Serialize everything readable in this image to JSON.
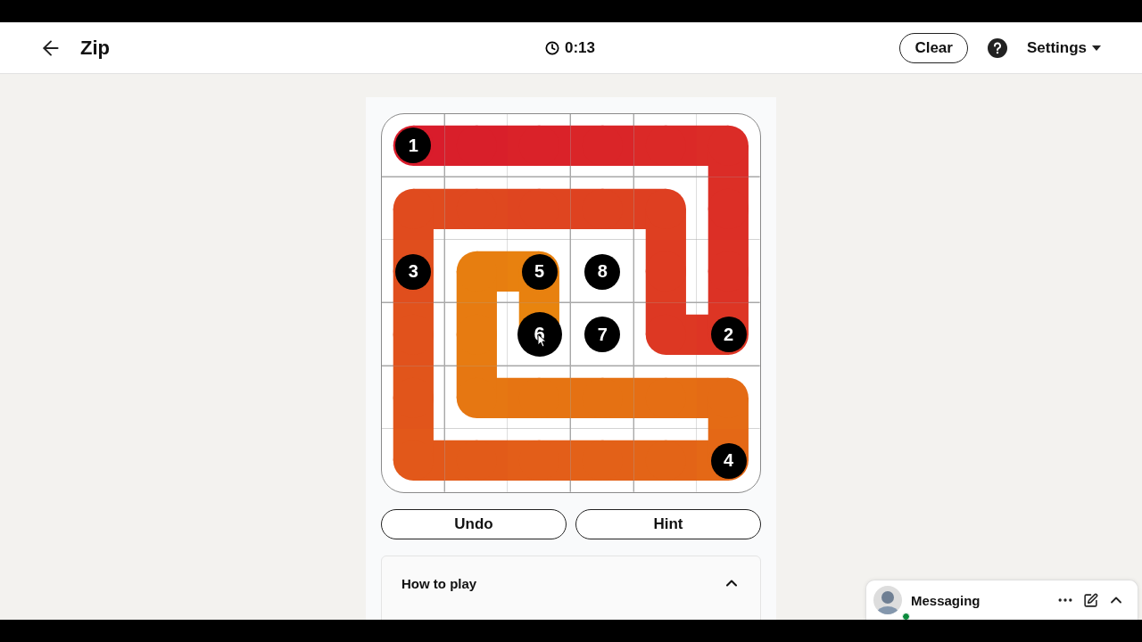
{
  "header": {
    "title": "Zip",
    "timer": "0:13",
    "clear_button": "Clear",
    "settings": "Settings"
  },
  "board": {
    "rows": [
      [
        {
          "kind": "dot",
          "label": "1",
          "current": false,
          "joins_right": true,
          "joins_down": false
        },
        {
          "kind": "empty",
          "joins_right": true,
          "joins_down": false
        },
        {
          "kind": "empty",
          "joins_right": true,
          "joins_down": false
        },
        {
          "kind": "empty",
          "joins_right": true,
          "joins_down": false
        },
        {
          "kind": "empty",
          "joins_right": true,
          "joins_down": false
        },
        {
          "kind": "empty",
          "joins_right": false,
          "joins_down": true
        }
      ],
      [
        {
          "kind": "empty",
          "joins_right": true,
          "joins_down": true
        },
        {
          "kind": "empty",
          "joins_right": true,
          "joins_down": false
        },
        {
          "kind": "empty",
          "joins_right": true,
          "joins_down": false
        },
        {
          "kind": "empty",
          "joins_right": true,
          "joins_down": false
        },
        {
          "kind": "empty",
          "joins_right": false,
          "joins_down": true
        },
        {
          "kind": "empty",
          "joins_right": false,
          "joins_down": true
        }
      ],
      [
        {
          "kind": "dot",
          "label": "3",
          "current": false,
          "joins_right": false,
          "joins_down": true
        },
        {
          "kind": "empty",
          "joins_right": true,
          "joins_down": true
        },
        {
          "kind": "dot",
          "label": "5",
          "current": false,
          "joins_right": false,
          "joins_down": true
        },
        {
          "kind": "dot",
          "label": "8",
          "current": false,
          "joins_right": false,
          "joins_down": false
        },
        {
          "kind": "empty",
          "joins_right": false,
          "joins_down": true
        },
        {
          "kind": "empty",
          "joins_right": false,
          "joins_down": true
        }
      ],
      [
        {
          "kind": "empty",
          "joins_right": false,
          "joins_down": true
        },
        {
          "kind": "empty",
          "joins_right": false,
          "joins_down": true
        },
        {
          "kind": "dot",
          "label": "6",
          "current": true,
          "joins_right": false,
          "joins_down": false
        },
        {
          "kind": "dot",
          "label": "7",
          "current": false,
          "joins_right": false,
          "joins_down": false
        },
        {
          "kind": "empty",
          "joins_right": true,
          "joins_down": false
        },
        {
          "kind": "dot",
          "label": "2",
          "current": false,
          "joins_right": false,
          "joins_down": false
        }
      ],
      [
        {
          "kind": "empty",
          "joins_right": false,
          "joins_down": true
        },
        {
          "kind": "empty",
          "joins_right": true,
          "joins_down": false
        },
        {
          "kind": "empty",
          "joins_right": true,
          "joins_down": false
        },
        {
          "kind": "empty",
          "joins_right": true,
          "joins_down": false
        },
        {
          "kind": "empty",
          "joins_right": true,
          "joins_down": false
        },
        {
          "kind": "empty",
          "joins_right": false,
          "joins_down": true
        }
      ],
      [
        {
          "kind": "empty",
          "joins_right": true,
          "joins_down": false
        },
        {
          "kind": "empty",
          "joins_right": true,
          "joins_down": false
        },
        {
          "kind": "empty",
          "joins_right": true,
          "joins_down": false
        },
        {
          "kind": "empty",
          "joins_right": true,
          "joins_down": false
        },
        {
          "kind": "empty",
          "joins_right": true,
          "joins_down": false
        },
        {
          "kind": "dot",
          "label": "4",
          "current": false,
          "joins_right": false,
          "joins_down": false
        }
      ]
    ]
  },
  "buttons": [
    "Undo",
    "Hint"
  ],
  "how_to_play": {
    "title": "How to play",
    "expanded": true
  },
  "messaging": {
    "label": "Messaging",
    "online": true
  }
}
